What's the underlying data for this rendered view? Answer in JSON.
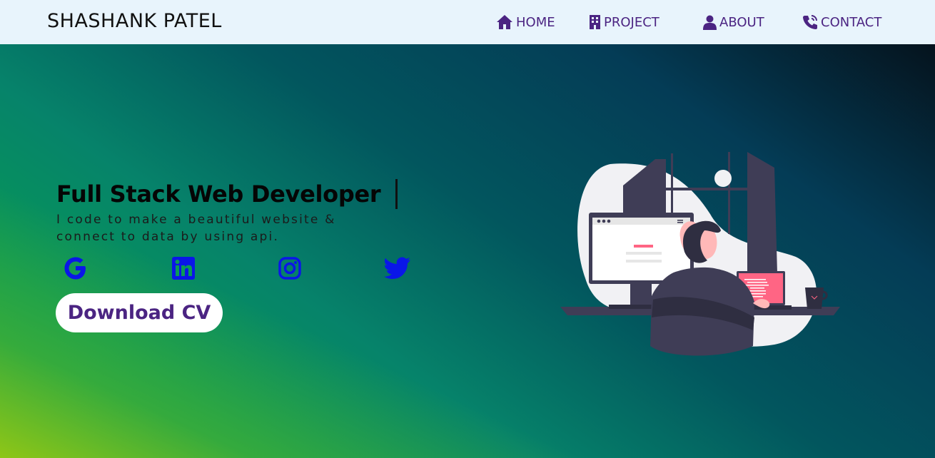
{
  "brand": "SHASHANK PATEL",
  "nav": [
    {
      "label": "HOME",
      "icon": "home-icon"
    },
    {
      "label": "PROJECT",
      "icon": "building-icon"
    },
    {
      "label": "ABOUT",
      "icon": "user-icon"
    },
    {
      "label": "CONTACT",
      "icon": "phone-icon"
    }
  ],
  "hero": {
    "headline": "Full Stack Web Developer",
    "subtitle": "I code to make a beautiful website & connect to data by using api.",
    "socials": [
      "google-icon",
      "linkedin-icon",
      "instagram-icon",
      "twitter-icon"
    ],
    "cta_label": "Download CV"
  },
  "colors": {
    "nav_bg": "#e8f4fc",
    "accent": "#4b2482",
    "social": "#0a16e8",
    "hero_gradient": [
      "#05131d",
      "#043c56",
      "#02565e",
      "#079758",
      "#8cc21a"
    ]
  }
}
